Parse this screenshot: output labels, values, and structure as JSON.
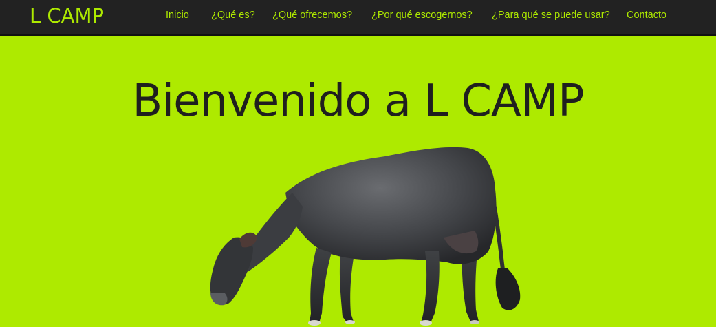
{
  "navbar": {
    "brand": "L CAMP",
    "links": [
      "Inicio",
      "¿Qué es?",
      "¿Qué ofrecemos?",
      "¿Por qué escogernos?",
      "¿Para qué se puede usar?",
      "Contacto"
    ]
  },
  "hero": {
    "title": "Bienvenido a L CAMP",
    "image": "grazing-cow"
  },
  "colors": {
    "accent": "#aeea00",
    "navbar_bg": "#222222",
    "title_text": "#1f1f1f"
  }
}
